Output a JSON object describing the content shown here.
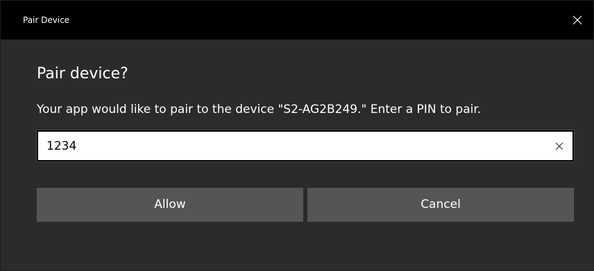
{
  "window": {
    "title": "Pair Device"
  },
  "dialog": {
    "heading": "Pair device?",
    "description": "Your app would like to pair to the device \"S2-AG2B249.\" Enter a PIN to pair.",
    "pin_value": "1234",
    "allow_label": "Allow",
    "cancel_label": "Cancel"
  },
  "icons": {
    "close": "close-icon",
    "clear": "clear-input-icon"
  },
  "colors": {
    "titlebar": "#000000",
    "background": "#2b2b2b",
    "button": "#555555",
    "input": "#ffffff",
    "text": "#ffffff"
  }
}
